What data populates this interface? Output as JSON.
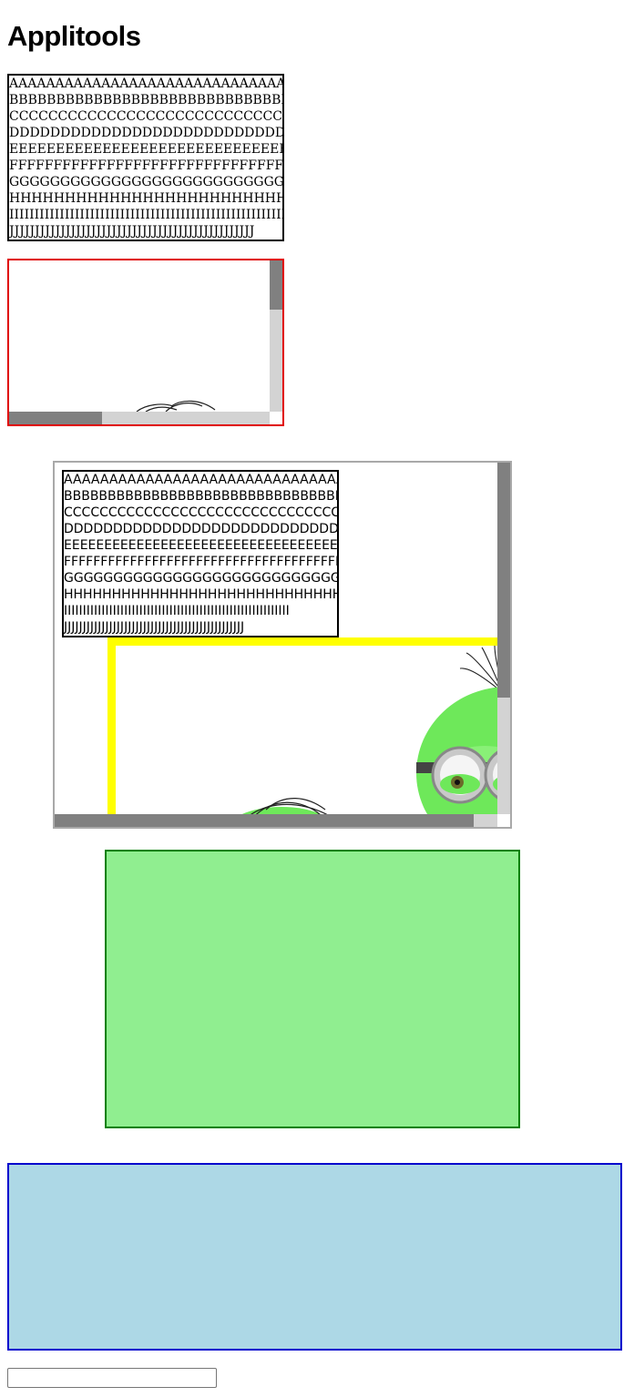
{
  "page": {
    "title": "Applitools"
  },
  "text_block_lines": [
    "AAAAAAAAAAAAAAAAAAAAAAAAAAAAAAAAAAAAAAAA",
    "BBBBBBBBBBBBBBBBBBBBBBBBBBBBBBBBBBBBBBBB",
    "CCCCCCCCCCCCCCCCCCCCCCCCCCCCCCCCCCCCCCCC",
    "DDDDDDDDDDDDDDDDDDDDDDDDDDDDDDDDDDDDDDDD",
    "EEEEEEEEEEEEEEEEEEEEEEEEEEEEEEEEEEEEEEEE",
    "FFFFFFFFFFFFFFFFFFFFFFFFFFFFFFFFFFFFFFFF",
    "GGGGGGGGGGGGGGGGGGGGGGGGGGGGGGGGGGGGGGGG",
    "HHHHHHHHHHHHHHHHHHHHHHHHHHHHHHHHHHHHHHHH",
    "IIIIIIIIIIIIIIIIIIIIIIIIIIIIIIIIIIIIIIIIIIIIIIIIIIIIIIIIIIII",
    "JJJJJJJJJJJJJJJJJJJJJJJJJJJJJJJJJJJJJJJJJJJJJJJJ"
  ],
  "colors": {
    "red_border": "#e00000",
    "yellow_border": "#ffff00",
    "green_fill": "#90ee90",
    "green_border": "#008000",
    "blue_fill": "#add8e6",
    "blue_border": "#0000cd",
    "minion_skin": "#6ee85a"
  },
  "icons": {
    "minion_image": "minion-image"
  },
  "text_input": {
    "value": "",
    "placeholder": ""
  }
}
